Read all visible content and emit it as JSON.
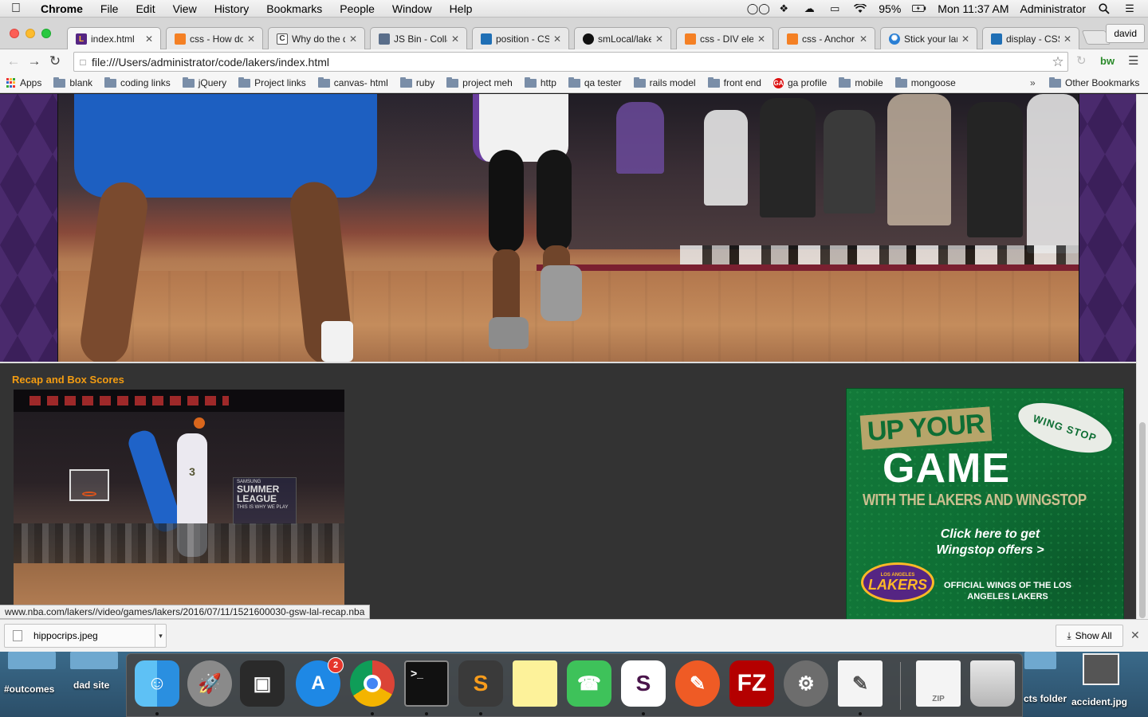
{
  "menubar": {
    "app_name": "Chrome",
    "items": [
      "File",
      "Edit",
      "View",
      "History",
      "Bookmarks",
      "People",
      "Window",
      "Help"
    ],
    "battery": "95%",
    "clock": "Mon 11:37 AM",
    "user": "Administrator"
  },
  "tabs": [
    {
      "title": "index.html",
      "favicon": "lakers-icon",
      "active": true
    },
    {
      "title": "css - How do I",
      "favicon": "stackoverflow-icon"
    },
    {
      "title": "Why do the di",
      "favicon": "page-icon"
    },
    {
      "title": "JS Bin - Collab",
      "favicon": "jsbin-icon"
    },
    {
      "title": "position - CSS",
      "favicon": "mdn-icon"
    },
    {
      "title": "smLocal/laker",
      "favicon": "github-icon"
    },
    {
      "title": "css - DIV elem",
      "favicon": "stackoverflow-icon"
    },
    {
      "title": "css - Anchor o",
      "favicon": "stackoverflow-icon"
    },
    {
      "title": "Stick your land",
      "favicon": "gear-icon"
    },
    {
      "title": "display - CSS",
      "favicon": "mdn-icon"
    }
  ],
  "profile_name": "david",
  "address_bar": {
    "url": "file:///Users/administrator/code/lakers/index.html"
  },
  "bookmarks": {
    "apps_label": "Apps",
    "items": [
      "blank",
      "coding links",
      "jQuery",
      "Project links",
      "canvas- html",
      "ruby",
      "project meh",
      "http",
      "qa tester",
      "rails model",
      "front end",
      "ga profile",
      "mobile",
      "mongoose"
    ],
    "overflow": "»",
    "other": "Other Bookmarks"
  },
  "page": {
    "recap_heading": "Recap and Box Scores",
    "ad": {
      "line1": "UP YOUR",
      "line2": "GAME",
      "line3": "WITH THE LAKERS AND WINGSTOP",
      "cta": "Click here to get Wingstop offers >",
      "brand": "WING STOP",
      "footer": "OFFICIAL WINGS OF THE LOS ANGELES LAKERS",
      "team": "LAKERS",
      "team_small": "LOS ANGELES"
    },
    "recap_image_text": {
      "banner": "SUMMER LEAGUE",
      "brand": "SAMSUNG",
      "tagline": "THIS IS WHY WE PLAY"
    }
  },
  "status_bar": {
    "link": "www.nba.com/lakers//video/games/lakers/2016/07/11/1521600030-gsw-lal-recap.nba"
  },
  "download_shelf": {
    "filename": "hippocrips.jpeg",
    "show_all": "Show All"
  },
  "desktop": {
    "labels": [
      "#outcomes",
      "dad site",
      "cts folder",
      "accident.jpg"
    ]
  },
  "dock": {
    "badge_count": "2",
    "apps": [
      "Finder",
      "Launchpad",
      "Photo Booth",
      "App Store",
      "Chrome",
      "Terminal",
      "Sublime Text",
      "Notes",
      "Facetime",
      "Slack",
      "Postman",
      "FileZilla",
      "System Preferences",
      "TextEdit",
      "Archive",
      "Trash"
    ]
  }
}
